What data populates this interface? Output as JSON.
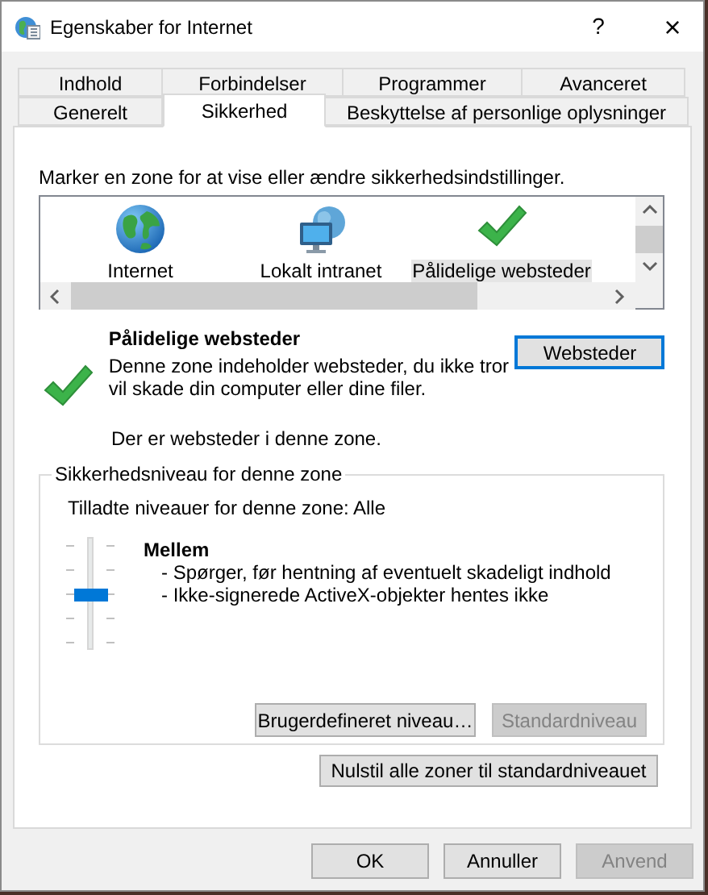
{
  "window": {
    "title": "Egenskaber for Internet",
    "help_button": "?",
    "close_button": "×"
  },
  "tab_rows": [
    [
      {
        "label": "Indhold",
        "selected": false
      },
      {
        "label": "Forbindelser",
        "selected": false
      },
      {
        "label": "Programmer",
        "selected": false
      },
      {
        "label": "Avanceret",
        "selected": false
      }
    ],
    [
      {
        "label": "Generelt",
        "selected": false
      },
      {
        "label": "Sikkerhed",
        "selected": true
      },
      {
        "label": "Beskyttelse af personlige oplysninger",
        "selected": false
      }
    ]
  ],
  "zone_prompt": "Marker en zone for at vise eller ændre sikkerhedsindstillinger.",
  "zones": [
    {
      "label": "Internet",
      "kind": "globe",
      "selected": false
    },
    {
      "label": "Lokalt intranet",
      "kind": "network",
      "selected": false
    },
    {
      "label": "Pålidelige websteder",
      "kind": "check",
      "selected": true
    }
  ],
  "zone_info": {
    "title": "Pålidelige websteder",
    "description": "Denne zone indeholder websteder, du ikke tror vil skade din computer eller dine filer.",
    "sites_button": {
      "label": "Websteder",
      "default": true
    },
    "status": "Der er websteder i denne zone."
  },
  "security_level": {
    "legend": "Sikkerhedsniveau for denne zone",
    "allowed": "Tilladte niveauer for denne zone: Alle",
    "level": 0.5,
    "level_name": "Mellem",
    "details": [
      "- Spørger, før hentning af eventuelt skadeligt indhold",
      "- Ikke-signerede ActiveX-objekter hentes ikke"
    ],
    "buttons": [
      {
        "label": "Brugerdefineret niveau…",
        "disabled": false
      },
      {
        "label": "Standardniveau",
        "disabled": true
      }
    ]
  },
  "reset_button": {
    "label": "Nulstil alle zoner til standardniveauet",
    "disabled": false
  },
  "dialog_buttons": [
    {
      "label": "OK",
      "disabled": false
    },
    {
      "label": "Annuller",
      "disabled": false
    },
    {
      "label": "Anvend",
      "disabled": true
    }
  ]
}
